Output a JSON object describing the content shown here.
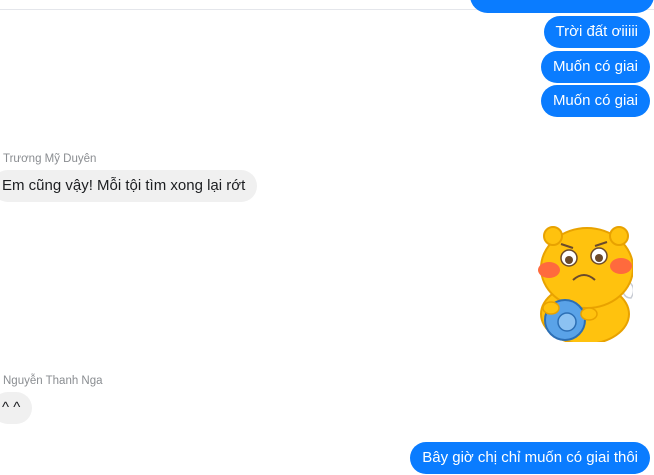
{
  "messages": [
    {
      "direction": "outgoing",
      "text": "Trời đất ơiiiii"
    },
    {
      "direction": "outgoing",
      "text": "Muốn có giai"
    },
    {
      "direction": "outgoing",
      "text": "Muốn có giai"
    },
    {
      "direction": "incoming",
      "sender": "Trương Mỹ Duyên",
      "text": "Em cũng vậy! Mỗi tội tìm xong lại rớt"
    },
    {
      "direction": "outgoing",
      "type": "sticker",
      "sticker": "crying-yellow-creature-sticker"
    },
    {
      "direction": "incoming",
      "sender": "Nguyễn Thanh Nga",
      "text": "^ ^"
    },
    {
      "direction": "outgoing",
      "text": "Bây giờ chị chỉ muốn có giai thôi"
    }
  ],
  "colors": {
    "outgoing_bubble": "#0a7cff",
    "incoming_bubble": "#f0f0f0",
    "sender_name": "#8a8d91"
  }
}
